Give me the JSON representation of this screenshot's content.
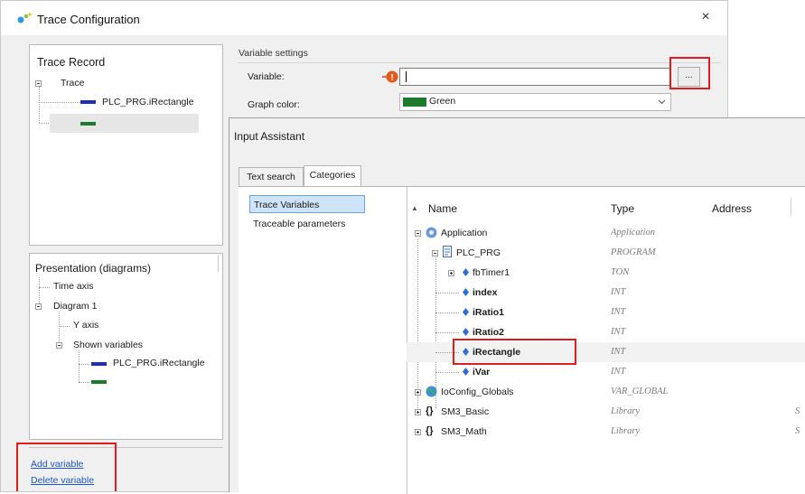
{
  "trace_config": {
    "title": "Trace Configuration",
    "close_glyph": "×",
    "trace_record": {
      "header": "Trace Record",
      "root": "Trace",
      "items": [
        "PLC_PRG.iRectangle"
      ]
    },
    "variable_settings": {
      "group_label": "Variable settings",
      "variable_label": "Variable:",
      "variable_value": "",
      "browse_button": "...",
      "graph_color_label": "Graph color:",
      "graph_color_value": "Green"
    },
    "presentation": {
      "header": "Presentation (diagrams)",
      "time_axis": "Time axis",
      "diagram": "Diagram 1",
      "y_axis": "Y axis",
      "shown_variables": "Shown variables",
      "items": [
        "PLC_PRG.iRectangle"
      ]
    },
    "links": {
      "add_variable": "Add variable",
      "delete_variable": "Delete variable"
    }
  },
  "input_assistant": {
    "title": "Input Assistant",
    "tabs": [
      "Text search",
      "Categories"
    ],
    "active_tab": "Categories",
    "categories": [
      "Trace Variables",
      "Traceable parameters"
    ],
    "selected_category": "Trace Variables",
    "columns": {
      "name": "Name",
      "type": "Type",
      "address": "Address"
    },
    "sort_glyph": "▲",
    "rows": [
      {
        "name": "Application",
        "type": "Application"
      },
      {
        "name": "PLC_PRG",
        "type": "PROGRAM"
      },
      {
        "name": "fbTimer1",
        "type": "TON"
      },
      {
        "name": "index",
        "type": "INT"
      },
      {
        "name": "iRatio1",
        "type": "INT"
      },
      {
        "name": "iRatio2",
        "type": "INT"
      },
      {
        "name": "iRectangle",
        "type": "INT"
      },
      {
        "name": "iVar",
        "type": "INT"
      },
      {
        "name": "IoConfig_Globals",
        "type": "VAR_GLOBAL"
      },
      {
        "name": "SM3_Basic",
        "type": "Library",
        "extra": "S"
      },
      {
        "name": "SM3_Math",
        "type": "Library",
        "extra": "S"
      }
    ],
    "brace_glyph": "{}"
  },
  "colors": {
    "accent_red": "#e31b1b",
    "green_swatch": "#1d7a2a",
    "blue_swatch": "#1d2fb7",
    "selection": "#cfe4f8",
    "link": "#1d57c9"
  }
}
